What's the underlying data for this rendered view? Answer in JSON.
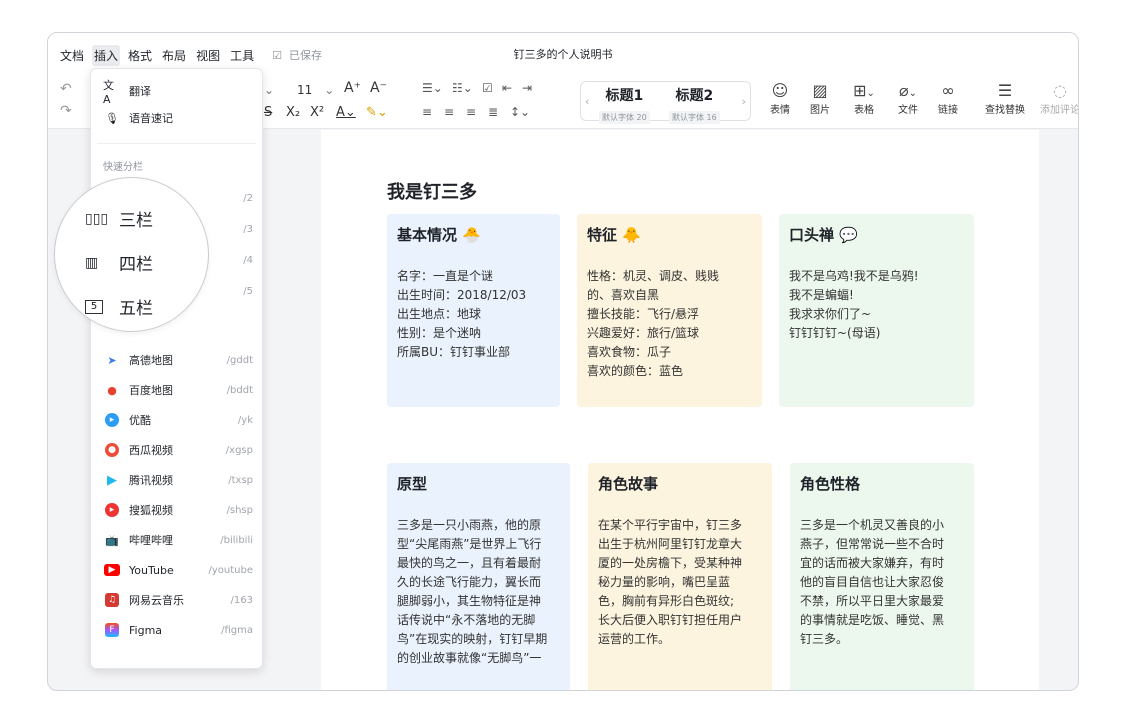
{
  "menu": {
    "items": [
      "文档",
      "插入",
      "格式",
      "布局",
      "视图",
      "工具"
    ],
    "saved": "已保存"
  },
  "title": "钉三多的个人说明书",
  "toolbar": {
    "font_size": "11",
    "style1": {
      "label": "标题1",
      "sub": "默认字体 20"
    },
    "style2": {
      "label": "标题2",
      "sub": "默认字体 16"
    },
    "tools": [
      "表情",
      "图片",
      "表格",
      "文件",
      "链接",
      "查找替换",
      "添加评论"
    ]
  },
  "dropdown": {
    "items_top": [
      {
        "label": "翻译",
        "icon": "translate-icon"
      },
      {
        "label": "语音速记",
        "icon": "microphone-icon"
      }
    ],
    "group": "快速分栏",
    "columns": [
      {
        "label": "三栏",
        "shortcut": "/2"
      },
      {
        "label": "四栏",
        "shortcut": "/3"
      },
      {
        "label": "五栏",
        "shortcut": "/4"
      },
      {
        "label": "",
        "shortcut": "/5"
      }
    ],
    "apps": [
      {
        "label": "高德地图",
        "shortcut": "/gddt",
        "color": "#3b7cf0"
      },
      {
        "label": "百度地图",
        "shortcut": "/bddt",
        "color": "#e8422f"
      },
      {
        "label": "优酷",
        "shortcut": "/yk",
        "color": "#2b9df4"
      },
      {
        "label": "西瓜视频",
        "shortcut": "/xgsp",
        "color": "#f04b3a"
      },
      {
        "label": "腾讯视频",
        "shortcut": "/txsp",
        "color": "#20b8ee"
      },
      {
        "label": "搜狐视频",
        "shortcut": "/shsp",
        "color": "#e33"
      },
      {
        "label": "哔哩哔哩",
        "shortcut": "/bilibili",
        "color": "#23aee5"
      },
      {
        "label": "YouTube",
        "shortcut": "/youtube",
        "color": "#f00"
      },
      {
        "label": "网易云音乐",
        "shortcut": "/163",
        "color": "#d33a31"
      },
      {
        "label": "Figma",
        "shortcut": "/figma",
        "color": "#a259ff"
      }
    ]
  },
  "doc": {
    "heading": "我是钉三多",
    "cards": [
      {
        "title": "基本情况 🐣",
        "body": [
          "名字：一直是个谜",
          "出生时间：2018/12/03",
          "出生地点：地球",
          "性别：是个迷呐",
          "所属BU：钉钉事业部"
        ]
      },
      {
        "title": "特征 🐥",
        "body": [
          "性格：机灵、调皮、贱贱",
          "的、喜欢自黑",
          "擅长技能：飞行/悬浮",
          "兴趣爱好：旅行/篮球",
          "喜欢食物：瓜子",
          "喜欢的颜色：蓝色"
        ]
      },
      {
        "title": "口头禅 💬",
        "body": [
          "我不是乌鸡!我不是乌鸦!",
          "我不是蝙蝠!",
          "我求求你们了~",
          "钉钉钉钉~(母语)"
        ]
      },
      {
        "title": "原型",
        "body": [
          "三多是一只小雨燕，他的原",
          "型“尖尾雨燕”是世界上飞行",
          "最快的鸟之一，且有着最耐",
          "久的长途飞行能力，翼长而",
          "腿脚弱小，其生物特征是神",
          "话传说中“永不落地的无脚",
          "鸟”在现实的映射，钉钉早期",
          "的创业故事就像“无脚鸟”一"
        ]
      },
      {
        "title": "角色故事",
        "body": [
          "在某个平行宇宙中，钉三多",
          "出生于杭州阿里钉钉龙章大",
          "厦的一处房檐下，受某种神",
          "秘力量的影响，嘴巴呈蓝",
          "色，胸前有异形白色斑纹;",
          "长大后便入职钉钉担任用户",
          "运营的工作。"
        ]
      },
      {
        "title": "角色性格",
        "body": [
          "三多是一个机灵又善良的小",
          "燕子，但常常说一些不合时",
          "宜的话而被大家嫌弃，有时",
          "他的盲目自信也让大家忍俊",
          "不禁，所以平日里大家最爱",
          "的事情就是吃饭、睡觉、黑",
          "钉三多。"
        ]
      }
    ]
  }
}
